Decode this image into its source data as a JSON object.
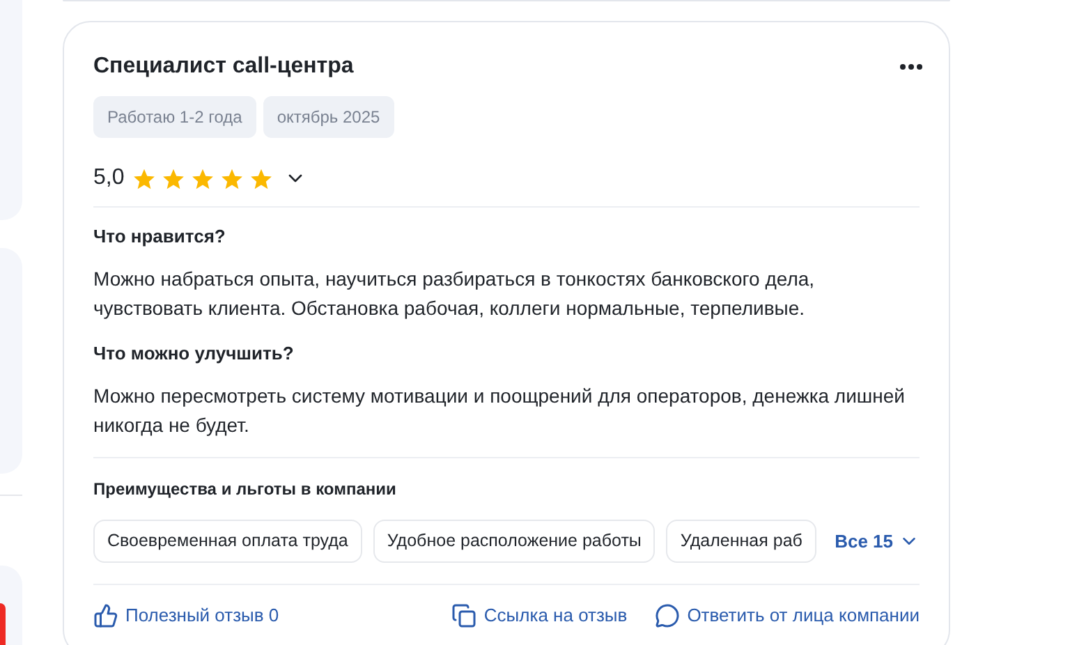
{
  "review": {
    "title": "Специалист call-центра",
    "tags": [
      "Работаю 1-2 года",
      "октябрь 2025"
    ],
    "rating": "5,0",
    "stars": 5,
    "sections": [
      {
        "heading": "Что нравится?",
        "text": "Можно набраться опыта, научиться разбираться в тонкостях банковского дела, чувствовать клиента. Обстановка рабочая, коллеги нормальные, терпеливые."
      },
      {
        "heading": "Что можно улучшить?",
        "text": "Можно пересмотреть систему мотивации и поощрений для операторов, денежка лишней никогда не будет."
      }
    ],
    "benefits": {
      "title": "Преимущества и льготы в компании",
      "items": [
        "Своевременная оплата труда",
        "Удобное расположение работы",
        "Удаленная раб"
      ],
      "more": "Все 15"
    },
    "actions": [
      {
        "kind": "like",
        "label": "Полезный отзыв 0"
      },
      {
        "kind": "link",
        "label": "Ссылка на отзыв"
      },
      {
        "kind": "reply",
        "label": "Ответить от лица компании"
      }
    ]
  }
}
